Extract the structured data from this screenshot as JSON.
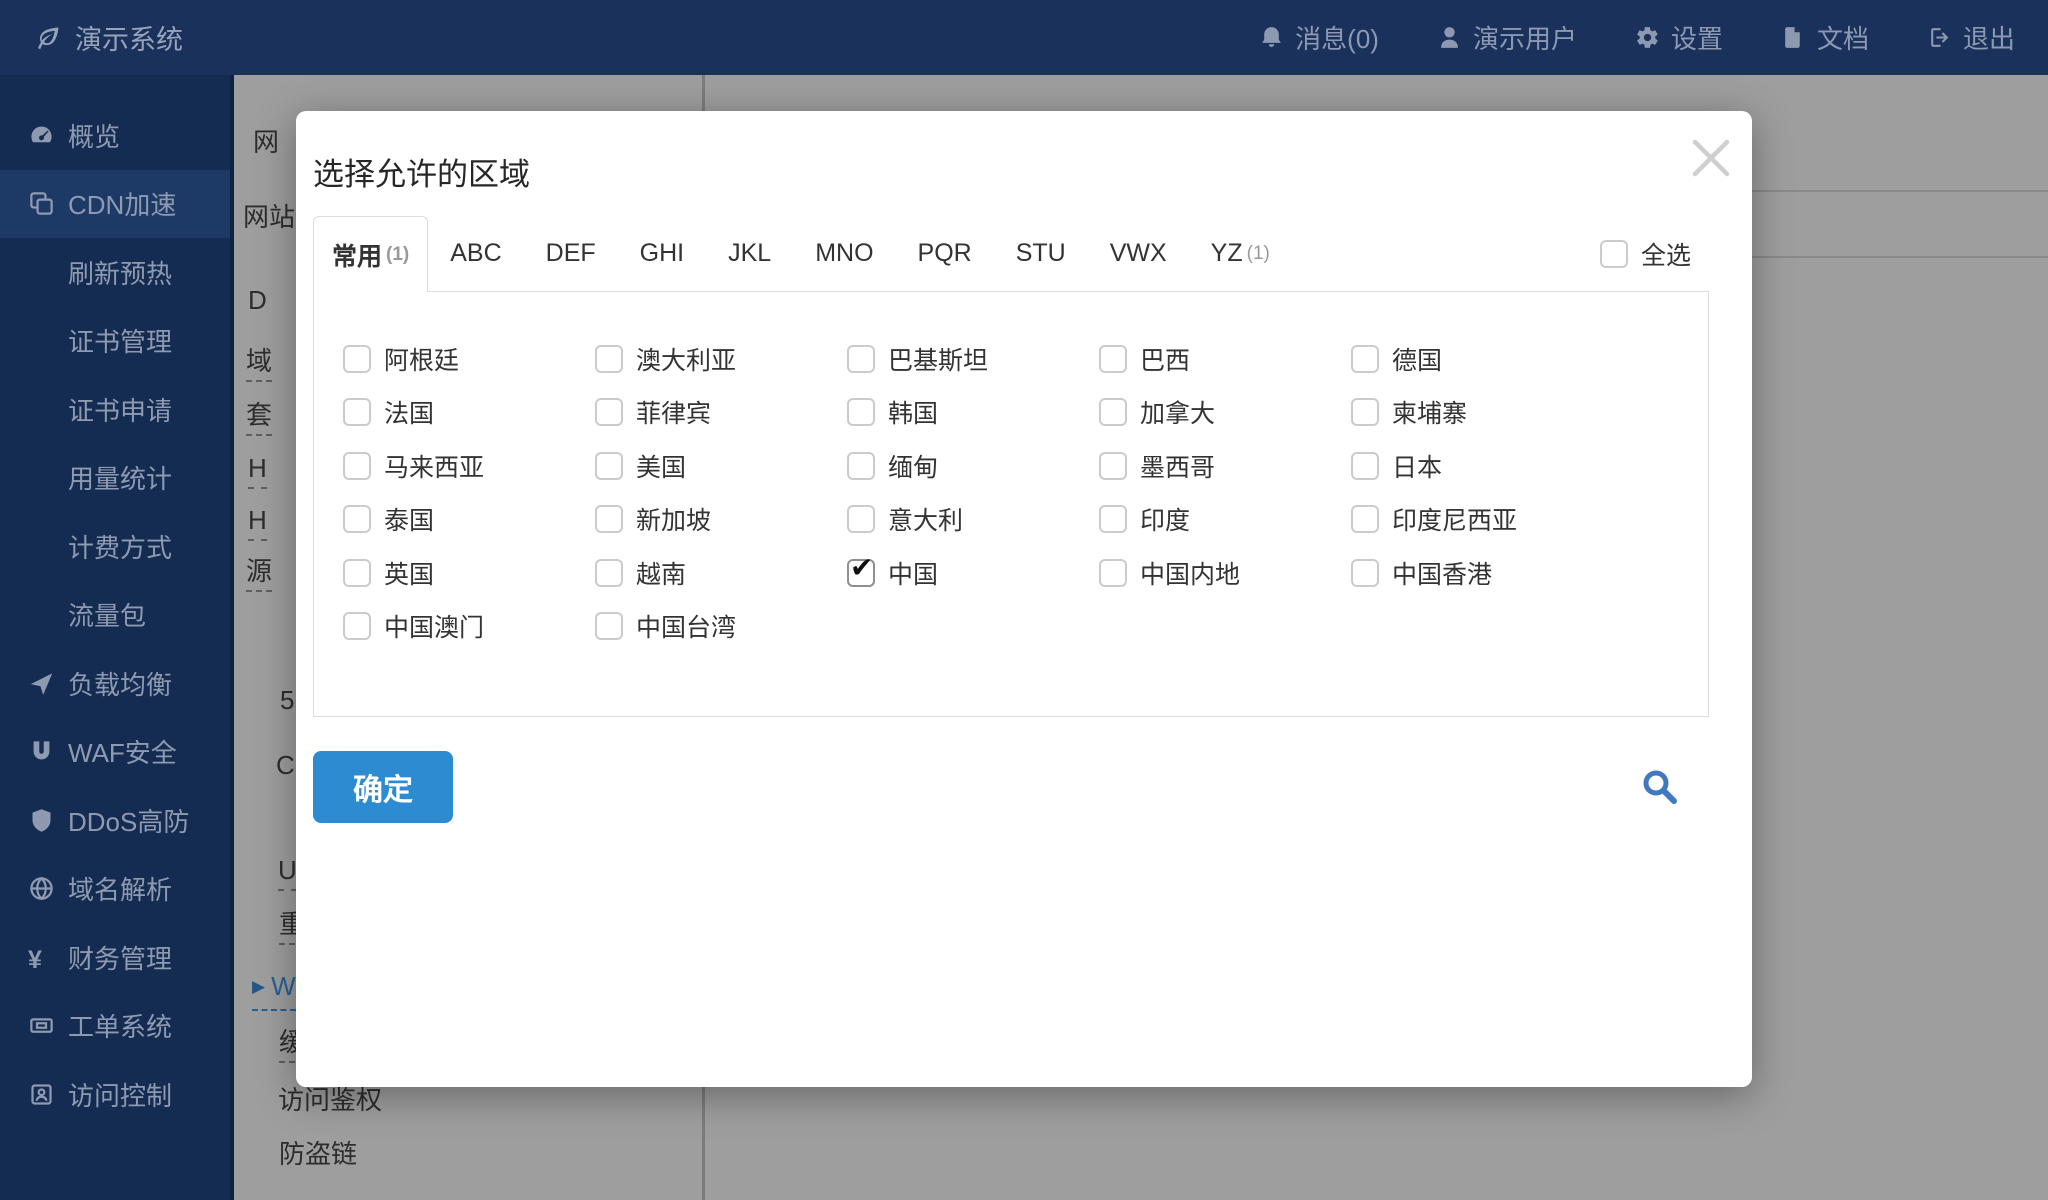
{
  "colors": {
    "topbar_bg": "#1a315c",
    "sidebar_bg": "#142c52",
    "side_active_bg": "#1d3a66",
    "accent": "#2d8cd1",
    "search_blue": "#4178be",
    "link_blue": "#3d9ef0"
  },
  "topbar": {
    "logo": "演示系统",
    "logo_icon": "leaf-icon",
    "menu": [
      {
        "name": "messages",
        "icon": "bell-icon",
        "label": "消息(0)"
      },
      {
        "name": "user",
        "icon": "user-icon",
        "label": "演示用户"
      },
      {
        "name": "settings",
        "icon": "gear-icon",
        "label": "设置"
      },
      {
        "name": "docs",
        "icon": "file-icon",
        "label": "文档"
      },
      {
        "name": "logout",
        "icon": "signout-icon",
        "label": "退出"
      }
    ]
  },
  "sidebar": {
    "items": [
      {
        "name": "overview",
        "icon": "gauge-icon",
        "label": "概览"
      },
      {
        "name": "cdn",
        "icon": "cdn-icon",
        "label": "CDN加速",
        "active": true
      },
      {
        "name": "refresh-preheat",
        "label": "刷新预热",
        "sub": true
      },
      {
        "name": "cert-manage",
        "label": "证书管理",
        "sub": true
      },
      {
        "name": "cert-apply",
        "label": "证书申请",
        "sub": true
      },
      {
        "name": "usage-stats",
        "label": "用量统计",
        "sub": true
      },
      {
        "name": "billing-method",
        "label": "计费方式",
        "sub": true
      },
      {
        "name": "traffic-pack",
        "label": "流量包",
        "sub": true
      },
      {
        "name": "load-balance",
        "icon": "send-icon",
        "label": "负载均衡"
      },
      {
        "name": "waf",
        "icon": "magnet-icon",
        "label": "WAF安全"
      },
      {
        "name": "ddos",
        "icon": "shield-icon",
        "label": "DDoS高防"
      },
      {
        "name": "dns",
        "icon": "globe-icon",
        "label": "域名解析"
      },
      {
        "name": "finance",
        "icon": "yen-icon",
        "label": "财务管理"
      },
      {
        "name": "tickets",
        "icon": "ticket-icon",
        "label": "工单系统"
      },
      {
        "name": "access-control",
        "icon": "idcard-icon",
        "label": "访问控制"
      }
    ]
  },
  "background": {
    "labels": [
      {
        "text": "网"
      },
      {
        "text": "网站"
      },
      {
        "text": "D"
      },
      {
        "text": "域",
        "underline": true
      },
      {
        "text": "套",
        "underline": true
      },
      {
        "text": "H",
        "underline": true
      },
      {
        "text": "H",
        "underline": true
      },
      {
        "text": "源",
        "underline": true
      },
      {
        "text": "5"
      },
      {
        "text": "C"
      },
      {
        "text": "U",
        "underline": true
      },
      {
        "text": "重",
        "underline": true
      },
      {
        "text": "W",
        "underline": true,
        "link": true,
        "arrow": true
      },
      {
        "text": "缓",
        "underline": true
      },
      {
        "text": "访问鉴权"
      },
      {
        "text": "防盗链"
      }
    ]
  },
  "modal": {
    "title": "选择允许的区域",
    "close_icon": "close-icon",
    "tabs": [
      {
        "label": "常用",
        "count": "(1)",
        "active": true
      },
      {
        "label": "ABC"
      },
      {
        "label": "DEF"
      },
      {
        "label": "GHI"
      },
      {
        "label": "JKL"
      },
      {
        "label": "MNO"
      },
      {
        "label": "PQR"
      },
      {
        "label": "STU"
      },
      {
        "label": "VWX"
      },
      {
        "label": "YZ",
        "count": "(1)"
      }
    ],
    "select_all_label": "全选",
    "regions": [
      {
        "name": "阿根廷",
        "checked": false
      },
      {
        "name": "澳大利亚",
        "checked": false
      },
      {
        "name": "巴基斯坦",
        "checked": false
      },
      {
        "name": "巴西",
        "checked": false
      },
      {
        "name": "德国",
        "checked": false
      },
      {
        "name": "法国",
        "checked": false
      },
      {
        "name": "菲律宾",
        "checked": false
      },
      {
        "name": "韩国",
        "checked": false
      },
      {
        "name": "加拿大",
        "checked": false
      },
      {
        "name": "柬埔寨",
        "checked": false
      },
      {
        "name": "马来西亚",
        "checked": false
      },
      {
        "name": "美国",
        "checked": false
      },
      {
        "name": "缅甸",
        "checked": false
      },
      {
        "name": "墨西哥",
        "checked": false
      },
      {
        "name": "日本",
        "checked": false
      },
      {
        "name": "泰国",
        "checked": false
      },
      {
        "name": "新加坡",
        "checked": false
      },
      {
        "name": "意大利",
        "checked": false
      },
      {
        "name": "印度",
        "checked": false
      },
      {
        "name": "印度尼西亚",
        "checked": false
      },
      {
        "name": "英国",
        "checked": false
      },
      {
        "name": "越南",
        "checked": false
      },
      {
        "name": "中国",
        "checked": true
      },
      {
        "name": "中国内地",
        "checked": false
      },
      {
        "name": "中国香港",
        "checked": false
      },
      {
        "name": "中国澳门",
        "checked": false
      },
      {
        "name": "中国台湾",
        "checked": false
      }
    ],
    "confirm_label": "确定",
    "search_icon": "search-icon"
  }
}
